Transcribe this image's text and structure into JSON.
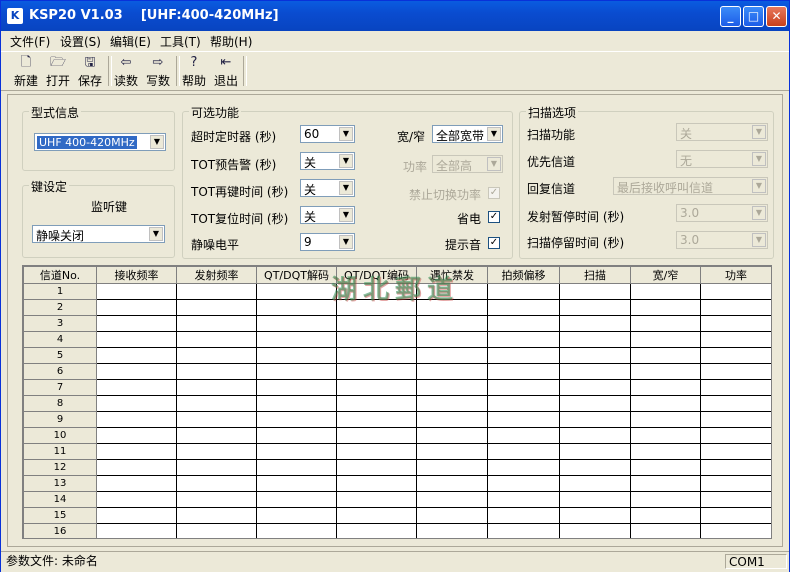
{
  "window": {
    "title": "KSP20 V1.03    [UHF:400-420MHz]",
    "icon_text": "K",
    "min_glyph": "_",
    "max_glyph": "□",
    "close_glyph": "✕"
  },
  "menu": [
    "文件(F)",
    "设置(S)",
    "编辑(E)",
    "工具(T)",
    "帮助(H)"
  ],
  "toolbar": {
    "new": "新建",
    "open": "打开",
    "save": "保存",
    "read": "读数",
    "write": "写数",
    "help": "帮助",
    "exit": "退出"
  },
  "model_group": {
    "legend": "型式信息",
    "model_value": "UHF 400-420MHz"
  },
  "key_group": {
    "legend": "键设定",
    "monitor_key_label": "监听键",
    "monitor_key_value": "静噪关闭"
  },
  "optional_group": {
    "legend": "可选功能",
    "timeout_label": "超时定时器 (秒)",
    "timeout_value": "60",
    "tot_prealert_label": "TOT预告警 (秒)",
    "tot_prealert_value": "关",
    "tot_rekey_label": "TOT再键时间 (秒)",
    "tot_rekey_value": "关",
    "tot_reset_label": "TOT复位时间 (秒)",
    "tot_reset_value": "关",
    "squelch_label": "静噪电平",
    "squelch_value": "9",
    "bandwidth_label": "宽/窄",
    "bandwidth_value": "全部宽带",
    "power_label": "功率",
    "power_value": "全部高",
    "no_power_switch_label": "禁止切换功率",
    "power_save_label": "省电",
    "beep_label": "提示音",
    "check_glyph": "✓"
  },
  "scan_group": {
    "legend": "扫描选项",
    "scan_label": "扫描功能",
    "scan_value": "关",
    "priority_label": "优先信道",
    "priority_value": "无",
    "revert_label": "回复信道",
    "revert_value": "最后接收呼叫信道",
    "tx_pause_label": "发射暂停时间 (秒)",
    "tx_pause_value": "3.0",
    "scan_dwell_label": "扫描停留时间 (秒)",
    "scan_dwell_value": "3.0"
  },
  "channel_table": {
    "headers": [
      "信道No.",
      "接收频率",
      "发射频率",
      "QT/DQT解码",
      "QT/DQT编码",
      "遇忙禁发",
      "拍频偏移",
      "扫描",
      "宽/窄",
      "功率"
    ],
    "rows": [
      "1",
      "2",
      "3",
      "4",
      "5",
      "6",
      "7",
      "8",
      "9",
      "10",
      "11",
      "12",
      "13",
      "14",
      "15",
      "16"
    ]
  },
  "watermark": "湖北郵道",
  "status": {
    "file": "参数文件: 未命名",
    "port": "COM1"
  }
}
